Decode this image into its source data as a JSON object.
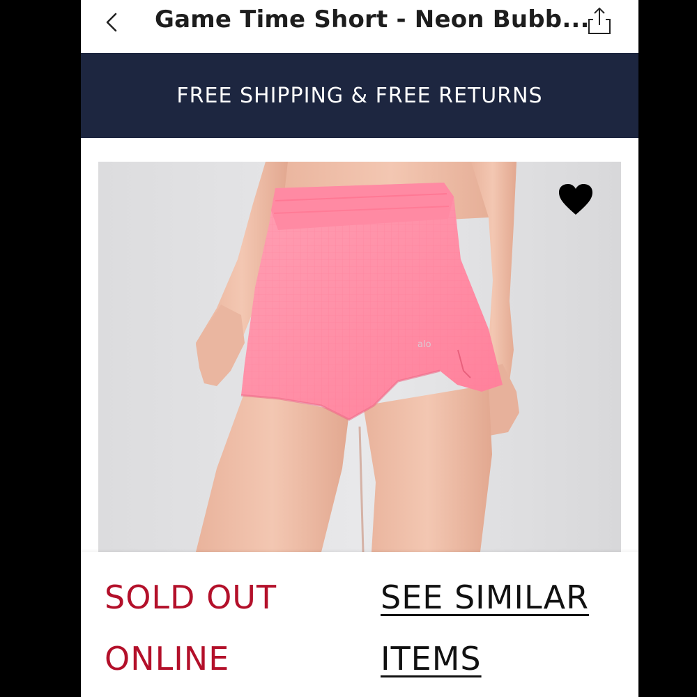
{
  "header": {
    "back_icon": "chevron-left-icon",
    "title": "Game Time Short - Neon Bubb...",
    "share_icon": "share-icon"
  },
  "promo": {
    "text": "FREE SHIPPING & FREE RETURNS",
    "background": "#1d2640"
  },
  "product": {
    "image_alt": "pink running shorts",
    "wishlist_icon": "heart-icon",
    "shorts_color": "#ff8fa8",
    "logo_text": "alo"
  },
  "availability": {
    "status_line1": "SOLD OUT",
    "status_line2": "ONLINE",
    "status_color": "#b3102a"
  },
  "similar": {
    "line1": "SEE SIMILAR",
    "line2": "ITEMS"
  }
}
